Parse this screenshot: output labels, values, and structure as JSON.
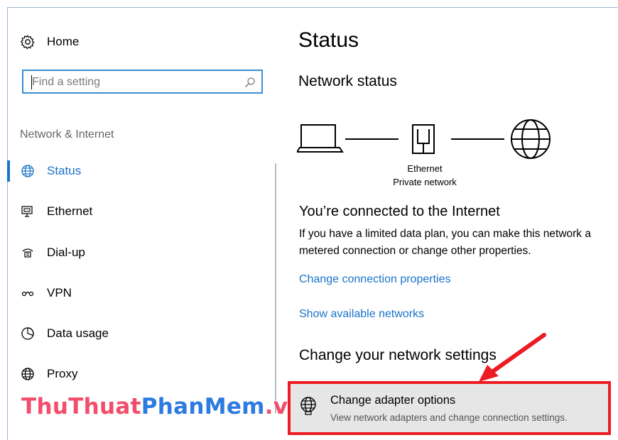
{
  "sidebar": {
    "home_label": "Home",
    "search": {
      "placeholder": "Find a setting"
    },
    "section_label": "Network & Internet",
    "items": [
      {
        "label": "Status",
        "icon": "globe-icon",
        "active": true
      },
      {
        "label": "Ethernet",
        "icon": "ethernet-icon",
        "active": false
      },
      {
        "label": "Dial-up",
        "icon": "dialup-icon",
        "active": false
      },
      {
        "label": "VPN",
        "icon": "vpn-icon",
        "active": false
      },
      {
        "label": "Data usage",
        "icon": "data-usage-icon",
        "active": false
      },
      {
        "label": "Proxy",
        "icon": "globe-icon",
        "active": false
      }
    ]
  },
  "watermark": {
    "part1": "ThuThuat",
    "part2": "PhanMem",
    "part3": ".vn"
  },
  "main": {
    "title": "Status",
    "network_status_heading": "Network status",
    "diagram": {
      "connection_name": "Ethernet",
      "network_type": "Private network"
    },
    "connected_heading": "You’re connected to the Internet",
    "connected_desc_line1": "If you have a limited data plan, you can make this network a",
    "connected_desc_line2": "metered connection or change other properties.",
    "links": {
      "change_connection_properties": "Change connection properties",
      "show_available_networks": "Show available networks"
    },
    "change_settings_heading": "Change your network settings",
    "adapter_options": {
      "title": "Change adapter options",
      "description": "View network adapters and change connection settings."
    }
  },
  "colors": {
    "accent": "#1a73c9",
    "highlight_border": "#ed1c24",
    "watermark_pink": "#f24d6b",
    "watermark_blue": "#2c7be0"
  }
}
